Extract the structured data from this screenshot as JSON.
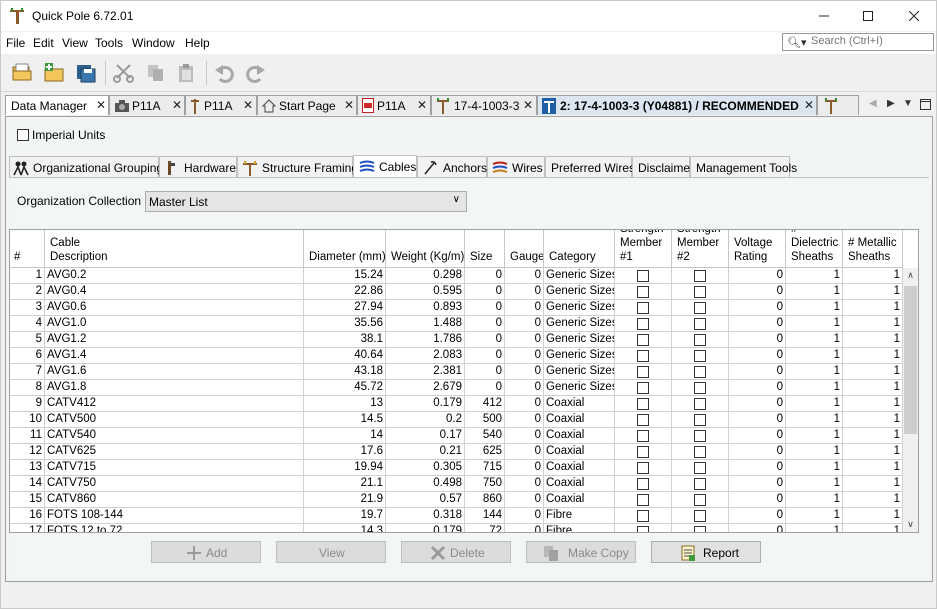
{
  "app": {
    "title": "Quick Pole 6.72.01"
  },
  "menu": [
    "File",
    "Edit",
    "View",
    "Tools",
    "Window",
    "Help"
  ],
  "search": {
    "placeholder": "Search (Ctrl+I)"
  },
  "doc_tabs": [
    {
      "label": "Data Manager",
      "icon": "none"
    },
    {
      "label": "P11A",
      "icon": "camera-icon"
    },
    {
      "label": "P11A",
      "icon": "pole-icon"
    },
    {
      "label": "Start Page",
      "icon": "home-icon"
    },
    {
      "label": "P11A",
      "icon": "pdf-icon"
    },
    {
      "label": "17-4-1003-3",
      "icon": "pole-icon"
    },
    {
      "label": "2: 17-4-1003-3 (Y04881) / RECOMMENDED",
      "icon": "pole-icon"
    }
  ],
  "imperial_units": {
    "label": "Imperial Units",
    "checked": false
  },
  "inner_tabs": [
    {
      "label": "Organizational Groupings",
      "icon": "people-icon"
    },
    {
      "label": "Hardware",
      "icon": "hardware-icon"
    },
    {
      "label": "Structure Framing",
      "icon": "framing-icon"
    },
    {
      "label": "Cables",
      "icon": "cables-icon"
    },
    {
      "label": "Anchors",
      "icon": "anchor-icon"
    },
    {
      "label": "Wires",
      "icon": "wires-icon"
    },
    {
      "label": "Preferred Wires",
      "icon": "none"
    },
    {
      "label": "Disclaimer",
      "icon": "none"
    },
    {
      "label": "Management Tools",
      "icon": "none"
    }
  ],
  "org": {
    "label": "Organization Collection",
    "value": "Master List"
  },
  "table": {
    "headers": [
      "#",
      "Cable\nDescription",
      "Diameter (mm)",
      "Weight (Kg/m)",
      "Size",
      "Gauge",
      "Category",
      "Strength\nMember\n#1",
      "Strength\nMember\n#2",
      "Voltage\nRating",
      "#\nDielectric\nSheaths",
      "# Metallic\nSheaths"
    ],
    "rows": [
      [
        "1",
        "AVG0.2",
        "15.24",
        "0.298",
        "0",
        "0",
        "Generic Sizes",
        "0",
        "1",
        "1"
      ],
      [
        "2",
        "AVG0.4",
        "22.86",
        "0.595",
        "0",
        "0",
        "Generic Sizes",
        "0",
        "1",
        "1"
      ],
      [
        "3",
        "AVG0.6",
        "27.94",
        "0.893",
        "0",
        "0",
        "Generic Sizes",
        "0",
        "1",
        "1"
      ],
      [
        "4",
        "AVG1.0",
        "35.56",
        "1.488",
        "0",
        "0",
        "Generic Sizes",
        "0",
        "1",
        "1"
      ],
      [
        "5",
        "AVG1.2",
        "38.1",
        "1.786",
        "0",
        "0",
        "Generic Sizes",
        "0",
        "1",
        "1"
      ],
      [
        "6",
        "AVG1.4",
        "40.64",
        "2.083",
        "0",
        "0",
        "Generic Sizes",
        "0",
        "1",
        "1"
      ],
      [
        "7",
        "AVG1.6",
        "43.18",
        "2.381",
        "0",
        "0",
        "Generic Sizes",
        "0",
        "1",
        "1"
      ],
      [
        "8",
        "AVG1.8",
        "45.72",
        "2.679",
        "0",
        "0",
        "Generic Sizes",
        "0",
        "1",
        "1"
      ],
      [
        "9",
        "CATV412",
        "13",
        "0.179",
        "412",
        "0",
        "Coaxial",
        "0",
        "1",
        "1"
      ],
      [
        "10",
        "CATV500",
        "14.5",
        "0.2",
        "500",
        "0",
        "Coaxial",
        "0",
        "1",
        "1"
      ],
      [
        "11",
        "CATV540",
        "14",
        "0.17",
        "540",
        "0",
        "Coaxial",
        "0",
        "1",
        "1"
      ],
      [
        "12",
        "CATV625",
        "17.6",
        "0.21",
        "625",
        "0",
        "Coaxial",
        "0",
        "1",
        "1"
      ],
      [
        "13",
        "CATV715",
        "19.94",
        "0.305",
        "715",
        "0",
        "Coaxial",
        "0",
        "1",
        "1"
      ],
      [
        "14",
        "CATV750",
        "21.1",
        "0.498",
        "750",
        "0",
        "Coaxial",
        "0",
        "1",
        "1"
      ],
      [
        "15",
        "CATV860",
        "21.9",
        "0.57",
        "860",
        "0",
        "Coaxial",
        "0",
        "1",
        "1"
      ],
      [
        "16",
        "FOTS 108-144",
        "19.7",
        "0.318",
        "144",
        "0",
        "Fibre",
        "0",
        "1",
        "1"
      ],
      [
        "17",
        "FOTS 12 to 72",
        "14.3",
        "0.179",
        "72",
        "0",
        "Fibre",
        "0",
        "1",
        "1"
      ]
    ]
  },
  "buttons": {
    "add": "Add",
    "view": "View",
    "delete": "Delete",
    "make_copy": "Make Copy",
    "report": "Report"
  }
}
